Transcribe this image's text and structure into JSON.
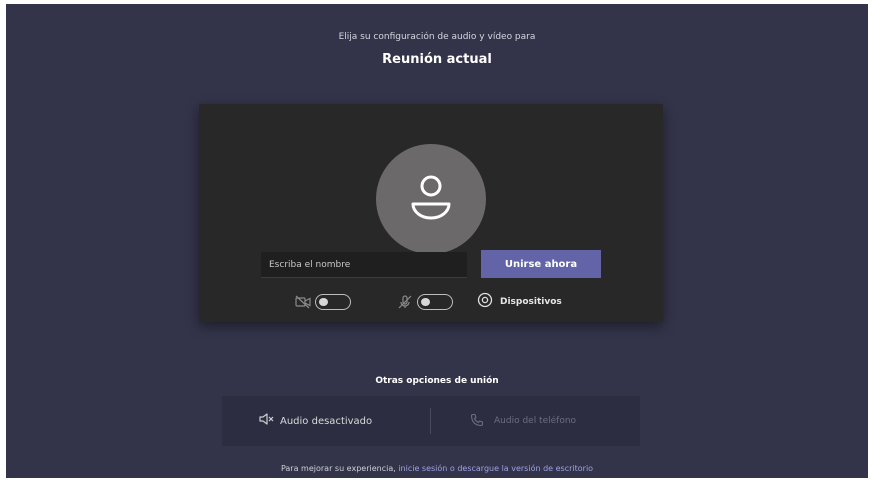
{
  "header": {
    "subtitle": "Elija su configuración de audio y vídeo para",
    "title": "Reunión actual"
  },
  "prejoin": {
    "avatar_icon": "person-icon",
    "name_input": {
      "placeholder": "Escriba el nombre",
      "value": ""
    },
    "join_button_label": "Unirse ahora",
    "controls": {
      "camera_icon": "camera-off-icon",
      "camera_toggle": "off",
      "mic_icon": "mic-off-icon",
      "mic_toggle": "off",
      "devices_icon": "gear-icon",
      "devices_label": "Dispositivos"
    }
  },
  "other_options": {
    "title": "Otras opciones de unión",
    "audio_off_label": "Audio desactivado",
    "phone_audio_label": "Audio del teléfono"
  },
  "footer": {
    "text": "Para mejorar su experiencia,",
    "link": "inicie sesión o descargue la versión de escritorio"
  },
  "colors": {
    "background": "#33344a",
    "card": "#292828",
    "accent": "#6264a7",
    "link": "#9ea2e0"
  }
}
